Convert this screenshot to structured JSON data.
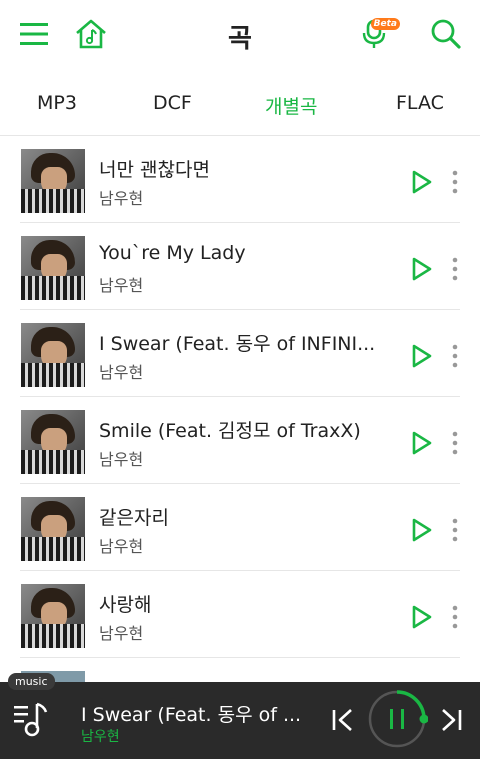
{
  "header": {
    "title": "곡",
    "beta_label": "Beta"
  },
  "tabs": [
    {
      "label": "MP3",
      "active": false
    },
    {
      "label": "DCF",
      "active": false
    },
    {
      "label": "개별곡",
      "active": true
    },
    {
      "label": "FLAC",
      "active": false
    }
  ],
  "songs": [
    {
      "title": "너만 괜찮다면",
      "artist": "남우현"
    },
    {
      "title": "You`re My Lady",
      "artist": "남우현"
    },
    {
      "title": "I Swear (Feat. 동우 of INFINI...",
      "artist": "남우현"
    },
    {
      "title": "Smile (Feat. 김정모 of TraxX)",
      "artist": "남우현"
    },
    {
      "title": "같은자리",
      "artist": "남우현"
    },
    {
      "title": "사랑해",
      "artist": "남우현"
    }
  ],
  "player": {
    "tag": "music",
    "now_playing_title": "I Swear (Feat. 동우 of ...",
    "now_playing_artist": "남우현",
    "progress": 0.25
  },
  "colors": {
    "accent": "#1ab744",
    "player_bg": "#2a2a2a",
    "beta_badge": "#ff7a1a"
  },
  "icons": [
    "menu-icon",
    "home-music-icon",
    "voice-search-icon",
    "search-icon",
    "play-icon",
    "more-icon",
    "prev-icon",
    "pause-icon",
    "next-icon",
    "playlist-icon"
  ]
}
